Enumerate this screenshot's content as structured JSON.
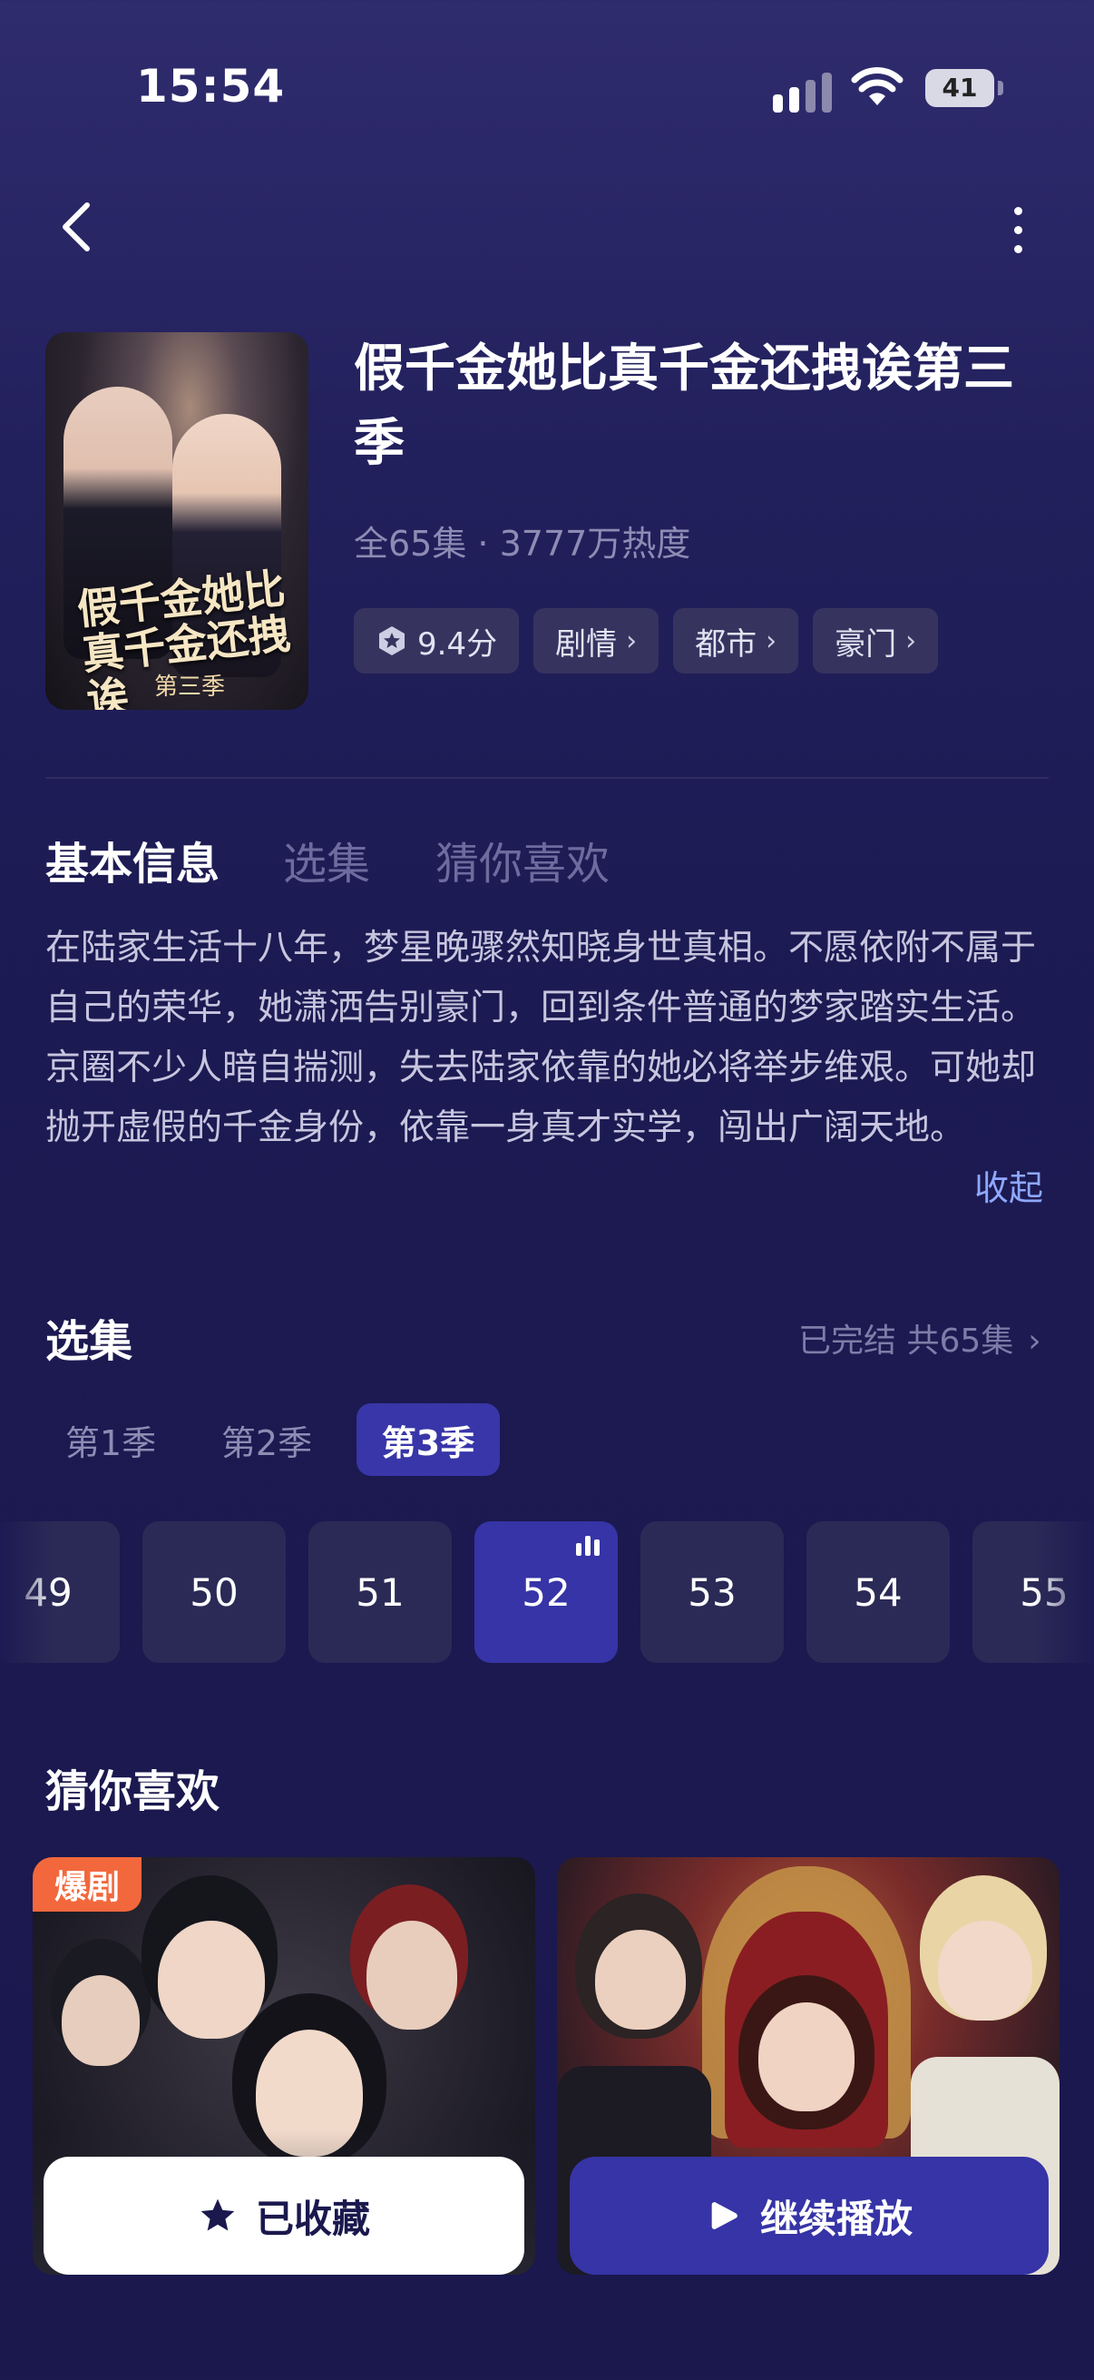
{
  "status_bar": {
    "time": "15:54",
    "battery": "41"
  },
  "header": {
    "title": "假千金她比真千金还拽诶第三季",
    "meta": "全65集 · 3777万热度",
    "rating": "9.4分",
    "tags": [
      "剧情",
      "都市",
      "豪门"
    ],
    "poster_title": "假千金她比真千金还拽诶",
    "poster_subtitle": "第三季"
  },
  "tabs": [
    "基本信息",
    "选集",
    "猜你喜欢"
  ],
  "description": "在陆家生活十八年，梦星晚骤然知晓身世真相。不愿依附不属于自己的荣华，她潇洒告别豪门，回到条件普通的梦家踏实生活。京圈不少人暗自揣测，失去陆家依靠的她必将举步维艰。可她却抛开虚假的千金身份，依靠一身真才实学，闯出广阔天地。",
  "collapse_label": "收起",
  "episodes_section": {
    "title": "选集",
    "status": "已完结 共65集",
    "seasons": [
      "第1季",
      "第2季",
      "第3季"
    ],
    "active_season": "第3季",
    "episodes": [
      "49",
      "50",
      "51",
      "52",
      "53",
      "54",
      "55"
    ],
    "current_episode": "52"
  },
  "recommend": {
    "title": "猜你喜欢",
    "badge": "爆剧"
  },
  "actions": {
    "favorite_label": "已收藏",
    "play_label": "继续播放"
  },
  "colors": {
    "accent": "#3634a6",
    "badge": "#f2683c",
    "link": "#8fa8ff"
  }
}
